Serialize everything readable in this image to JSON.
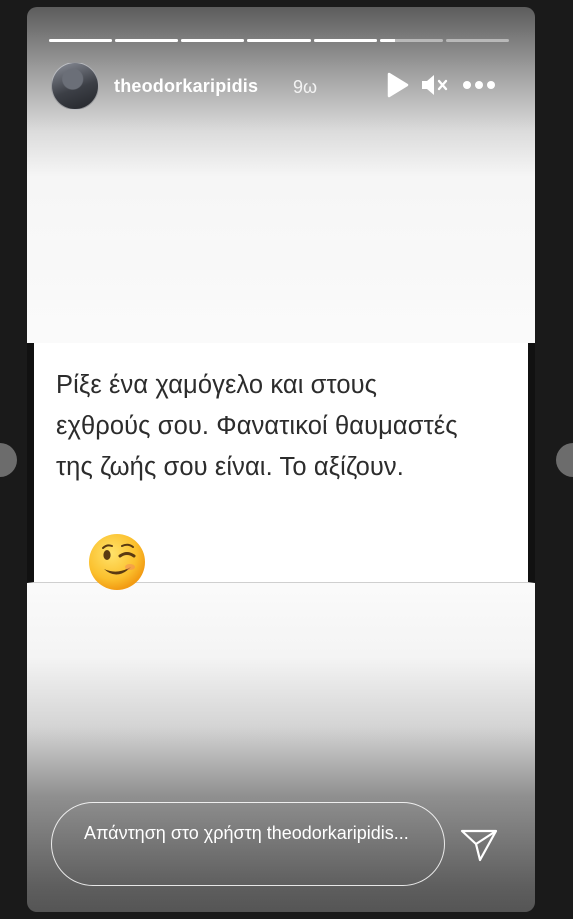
{
  "story": {
    "progress_segments": [
      1,
      1,
      1,
      1,
      1,
      0.24,
      0
    ],
    "username": "theodorkaripidis",
    "timestamp": "9ω",
    "icons": {
      "avatar": "user-avatar",
      "play": "play-icon",
      "mute": "speaker-muted-icon",
      "more": "more-options-icon",
      "send": "send-icon",
      "emoji": "winking-face-emoji"
    },
    "quote_lines": [
      "Ρίξε ένα χαμόγελο και στους",
      "εχθρούς σου. Φανατικοί θαυμαστές",
      "της ζωής σου είναι. Το αξίζουν."
    ],
    "reply_placeholder": "Απάντηση στο χρήστη theodorkaripidis..."
  }
}
